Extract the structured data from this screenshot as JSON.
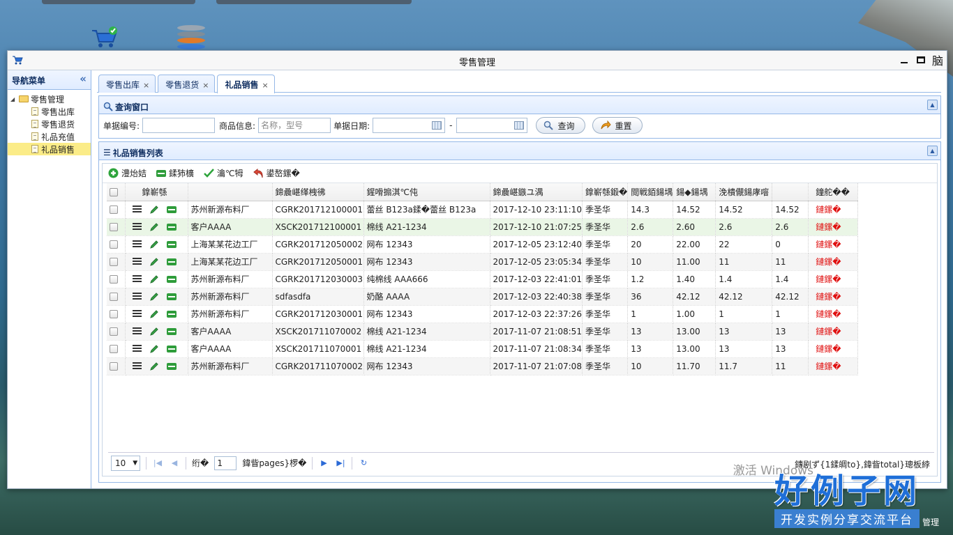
{
  "window": {
    "title": "零售管理",
    "close_glyph": "脑"
  },
  "sidebar": {
    "title": "导航菜单",
    "collapse_glyph": "«",
    "root": "零售管理",
    "items": [
      {
        "label": "零售出库",
        "selected": false
      },
      {
        "label": "零售退货",
        "selected": false
      },
      {
        "label": "礼品充值",
        "selected": false
      },
      {
        "label": "礼品销售",
        "selected": true
      }
    ]
  },
  "tabs": [
    {
      "label": "零售出库",
      "active": false
    },
    {
      "label": "零售退货",
      "active": false
    },
    {
      "label": "礼品销售",
      "active": true
    }
  ],
  "query": {
    "title": "查询窗口",
    "doc_no_label": "单据编号:",
    "doc_no_value": "",
    "goods_label": "商品信息:",
    "goods_placeholder": "名称，型号",
    "date_label": "单据日期:",
    "date_sep": "-",
    "search_button": "查询",
    "reset_button": "重置"
  },
  "list": {
    "title": "礼品销售列表",
    "toolbar": [
      "澧炲姞",
      "鍒犻櫎",
      "瀹℃牳",
      "鍙嶅鏍�"
    ],
    "columns": [
      "鎿嶄綔",
      "",
      "鍗曟嵁缂栧彿",
      "鍟嗗搧淇℃伅",
      "鍗曟嵁鏃ユ湡",
      "鎿嶄綔鍛�",
      "閲戦銆鍚堣",
      "鍚◆鍚堣",
      "浼樻儬鍚庨噾",
      "",
      "鐘舵��"
    ],
    "rows": [
      {
        "customer": "苏州新源布料厂",
        "no": "CGRK201712100001",
        "goods": "蕾丝 B123a鍒�蕾丝 B123a",
        "date": "2017-12-10 23:11:10",
        "op": "季圣华",
        "a": "14.3",
        "b": "14.52",
        "c": "14.52",
        "d": "14.52",
        "status": "鏈鏍�"
      },
      {
        "customer": "客户AAAA",
        "no": "XSCK201712100001",
        "goods": "棉线 A21-1234",
        "date": "2017-12-10 21:07:25",
        "op": "季圣华",
        "a": "2.6",
        "b": "2.60",
        "c": "2.6",
        "d": "2.6",
        "status": "鏈鏍�"
      },
      {
        "customer": "上海某某花边工厂",
        "no": "CGRK201712050002",
        "goods": "网布 12343",
        "date": "2017-12-05 23:12:40",
        "op": "季圣华",
        "a": "20",
        "b": "22.00",
        "c": "22",
        "d": "0",
        "status": "鏈鏍�"
      },
      {
        "customer": "上海某某花边工厂",
        "no": "CGRK201712050001",
        "goods": "网布 12343",
        "date": "2017-12-05 23:05:34",
        "op": "季圣华",
        "a": "10",
        "b": "11.00",
        "c": "11",
        "d": "11",
        "status": "鏈鏍�"
      },
      {
        "customer": "苏州新源布料厂",
        "no": "CGRK201712030003",
        "goods": "纯棉线 AAA666",
        "date": "2017-12-03 22:41:01",
        "op": "季圣华",
        "a": "1.2",
        "b": "1.40",
        "c": "1.4",
        "d": "1.4",
        "status": "鏈鏍�"
      },
      {
        "customer": "苏州新源布料厂",
        "no": "sdfasdfa",
        "goods": "奶酪 AAAA",
        "date": "2017-12-03 22:40:38",
        "op": "季圣华",
        "a": "36",
        "b": "42.12",
        "c": "42.12",
        "d": "42.12",
        "status": "鏈鏍�"
      },
      {
        "customer": "苏州新源布料厂",
        "no": "CGRK201712030001",
        "goods": "网布 12343",
        "date": "2017-12-03 22:37:26",
        "op": "季圣华",
        "a": "1",
        "b": "1.00",
        "c": "1",
        "d": "1",
        "status": "鏈鏍�"
      },
      {
        "customer": "客户AAAA",
        "no": "XSCK201711070002",
        "goods": "棉线 A21-1234",
        "date": "2017-11-07 21:08:51",
        "op": "季圣华",
        "a": "13",
        "b": "13.00",
        "c": "13",
        "d": "13",
        "status": "鏈鏍�"
      },
      {
        "customer": "客户AAAA",
        "no": "XSCK201711070001",
        "goods": "棉线 A21-1234",
        "date": "2017-11-07 21:08:34",
        "op": "季圣华",
        "a": "13",
        "b": "13.00",
        "c": "13",
        "d": "13",
        "status": "鏈鏍�"
      },
      {
        "customer": "苏州新源布料厂",
        "no": "CGRK201711070002",
        "goods": "网布 12343",
        "date": "2017-11-07 21:07:08",
        "op": "季圣华",
        "a": "10",
        "b": "11.70",
        "c": "11.7",
        "d": "11",
        "status": "鏈鏍�"
      }
    ]
  },
  "pager": {
    "page_size": "10",
    "page_prefix": "绗�",
    "page_value": "1",
    "page_suffix": "鍏眥pages}椤�",
    "info": "鏄剧ず{1鍒皗to},鍏眥total}璁板綍"
  },
  "watermark": {
    "activate": "激活 Windows",
    "brand": "好例子网",
    "slogan": "开发实例分享交流平台",
    "taskbar": "管理"
  },
  "colors": {
    "accent": "#95b8e7",
    "status_red": "#e01010",
    "selected": "#fbec88",
    "row_highlight": "#eaf6e6"
  }
}
